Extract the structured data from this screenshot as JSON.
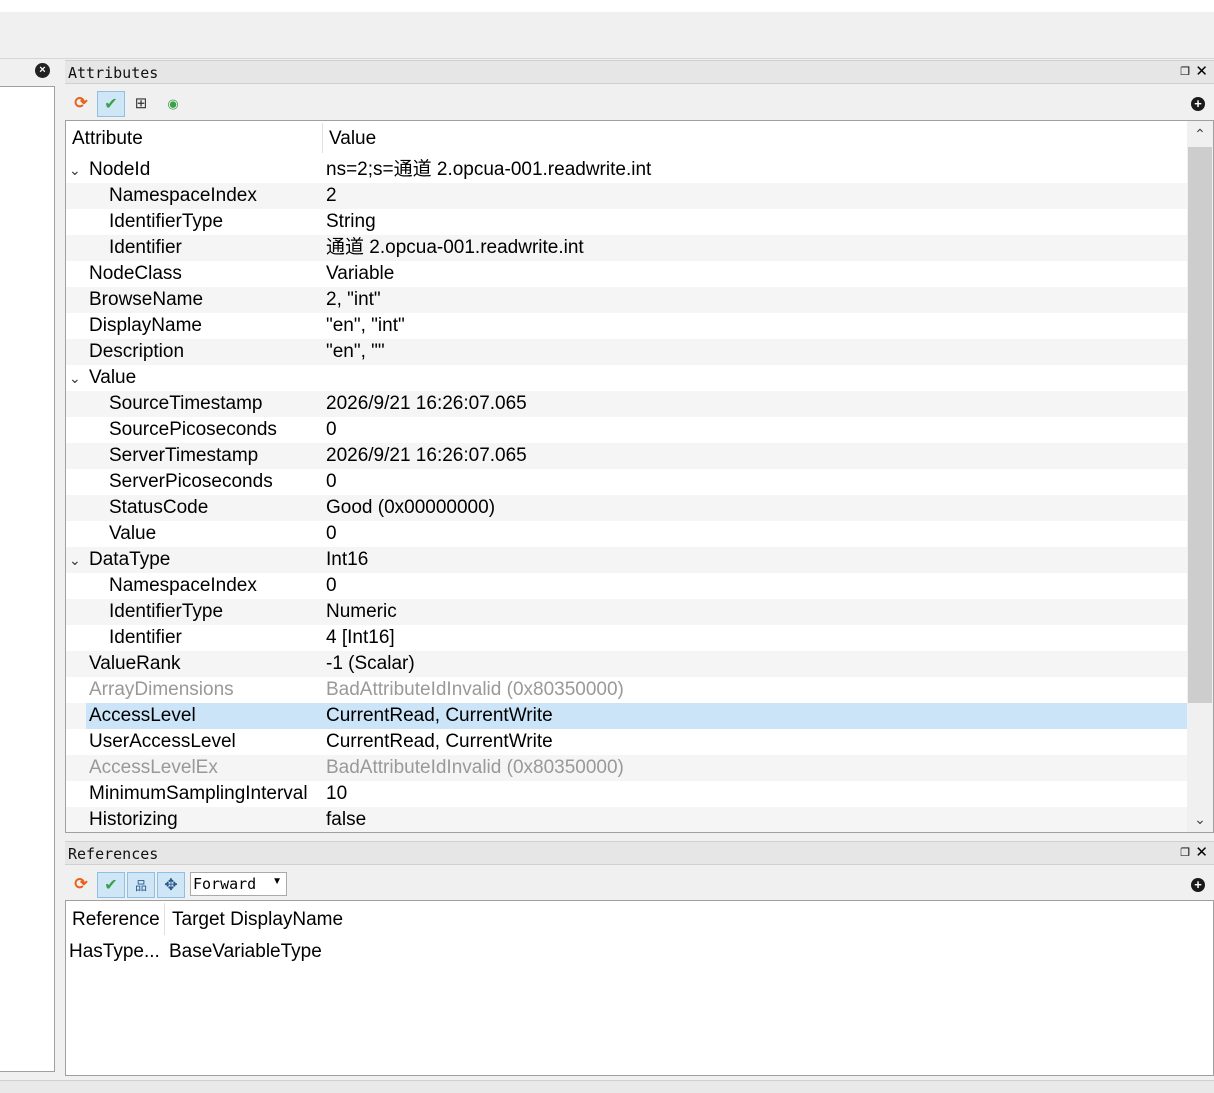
{
  "attributes_panel": {
    "title": "Attributes",
    "float_icon": "❐",
    "close_icon": "✕",
    "columns": [
      "Attribute",
      "Value"
    ],
    "rows": [
      {
        "name": "NodeId",
        "value": "ns=2;s=通道 2.opcua-001.readwrite.int",
        "level": 0,
        "expanded": true
      },
      {
        "name": "NamespaceIndex",
        "value": "2",
        "level": 1
      },
      {
        "name": "IdentifierType",
        "value": "String",
        "level": 1
      },
      {
        "name": "Identifier",
        "value": "通道 2.opcua-001.readwrite.int",
        "level": 1
      },
      {
        "name": "NodeClass",
        "value": "Variable",
        "level": 0
      },
      {
        "name": "BrowseName",
        "value": "2, \"int\"",
        "level": 0
      },
      {
        "name": "DisplayName",
        "value": "\"en\", \"int\"",
        "level": 0
      },
      {
        "name": "Description",
        "value": "\"en\", \"\"",
        "level": 0
      },
      {
        "name": "Value",
        "value": "",
        "level": 0,
        "expanded": true
      },
      {
        "name": "SourceTimestamp",
        "value": "2026/9/21 16:26:07.065",
        "level": 1
      },
      {
        "name": "SourcePicoseconds",
        "value": "0",
        "level": 1
      },
      {
        "name": "ServerTimestamp",
        "value": "2026/9/21 16:26:07.065",
        "level": 1
      },
      {
        "name": "ServerPicoseconds",
        "value": "0",
        "level": 1
      },
      {
        "name": "StatusCode",
        "value": "Good (0x00000000)",
        "level": 1
      },
      {
        "name": "Value",
        "value": "0",
        "level": 1
      },
      {
        "name": "DataType",
        "value": "Int16",
        "level": 0,
        "expanded": true
      },
      {
        "name": "NamespaceIndex",
        "value": "0",
        "level": 1
      },
      {
        "name": "IdentifierType",
        "value": "Numeric",
        "level": 1
      },
      {
        "name": "Identifier",
        "value": "4 [Int16]",
        "level": 1
      },
      {
        "name": "ValueRank",
        "value": "-1 (Scalar)",
        "level": 0
      },
      {
        "name": "ArrayDimensions",
        "value": "BadAttributeIdInvalid (0x80350000)",
        "level": 0,
        "dim": true
      },
      {
        "name": "AccessLevel",
        "value": "CurrentRead, CurrentWrite",
        "level": 0,
        "selected": true
      },
      {
        "name": "UserAccessLevel",
        "value": "CurrentRead, CurrentWrite",
        "level": 0
      },
      {
        "name": "AccessLevelEx",
        "value": "BadAttributeIdInvalid (0x80350000)",
        "level": 0,
        "dim": true
      },
      {
        "name": "MinimumSamplingInterval",
        "value": "10",
        "level": 0
      },
      {
        "name": "Historizing",
        "value": "false",
        "level": 0
      }
    ]
  },
  "references_panel": {
    "title": "References",
    "direction": "Forward",
    "columns": [
      "Reference",
      "Target DisplayName"
    ],
    "rows": [
      {
        "reference": "HasType...",
        "target": "BaseVariableType"
      }
    ]
  },
  "icons": {
    "refresh": "⟳",
    "check": "✔",
    "tree": "⊞",
    "dot": "◉",
    "plus": "+",
    "up": "⌃",
    "down": "⌄",
    "expand": "⌄",
    "close": "×",
    "hierarchy": "品",
    "move": "✥"
  },
  "colors": {
    "selection": "#cce4f7",
    "refresh": "#e8621a",
    "check": "#3aa04a"
  }
}
